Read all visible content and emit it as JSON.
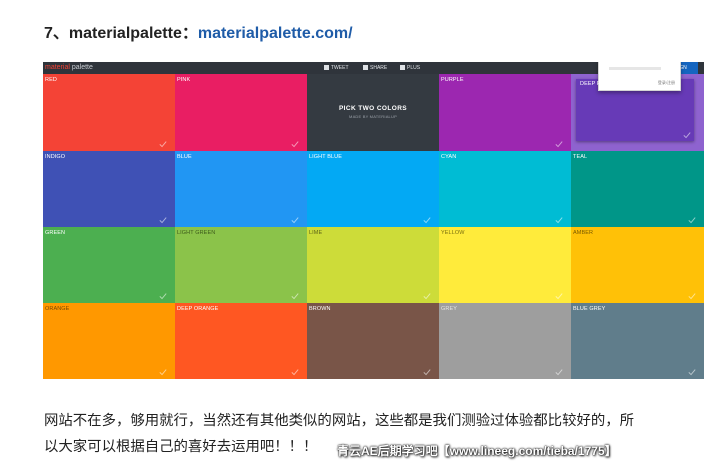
{
  "article": {
    "heading_prefix": "7、materialpalette：",
    "heading_link": "materialpalette.com/",
    "paragraph_line1": "网站不在多，够用就行，当然还有其他类似的网站，这些都是我们测验过体验都比较好的，所",
    "paragraph_line2": "以大家可以根据自己的喜好去运用吧！！！",
    "watermark": "青云AE后期学习吧【www.lineeg.com/tieba/1775】"
  },
  "screenshot": {
    "brand_accent": "material",
    "brand_rest": " palette",
    "tweet": "TWEET",
    "share": "SHARE",
    "plus": "PLUS",
    "signin": "GN",
    "popup_text": "登录/注册",
    "center_title": "PICK TWO COLORS",
    "center_subtitle": "MADE BY MATERIALUP",
    "tiles": [
      {
        "name": "RED",
        "color": "#f44336",
        "text_color": "#ffffff"
      },
      {
        "name": "PINK",
        "color": "#e91e63",
        "text_color": "#ffffff"
      },
      {
        "name": "",
        "color": "#343a41",
        "text_color": "#ffffff"
      },
      {
        "name": "PURPLE",
        "color": "#9c27b0",
        "text_color": "#ffffff"
      },
      {
        "name": "DEEP P",
        "color": "#673ab7",
        "text_color": "#ffffff"
      },
      {
        "name": "INDIGO",
        "color": "#3f51b5",
        "text_color": "#ffffff"
      },
      {
        "name": "BLUE",
        "color": "#2196f3",
        "text_color": "#ffffff"
      },
      {
        "name": "LIGHT BLUE",
        "color": "#03a9f4",
        "text_color": "#ffffff"
      },
      {
        "name": "CYAN",
        "color": "#00bcd4",
        "text_color": "#ffffff"
      },
      {
        "name": "TEAL",
        "color": "#009688",
        "text_color": "#ffffff"
      },
      {
        "name": "GREEN",
        "color": "#4caf50",
        "text_color": "#ffffff"
      },
      {
        "name": "LIGHT GREEN",
        "color": "#8bc34a",
        "text_color": "#3d5a1c"
      },
      {
        "name": "LIME",
        "color": "#cddc39",
        "text_color": "#5d6519"
      },
      {
        "name": "YELLOW",
        "color": "#ffeb3b",
        "text_color": "#7a6f10"
      },
      {
        "name": "AMBER",
        "color": "#ffc107",
        "text_color": "#7a5b00"
      },
      {
        "name": "ORANGE",
        "color": "#ff9800",
        "text_color": "#7a4900"
      },
      {
        "name": "DEEP ORANGE",
        "color": "#ff5722",
        "text_color": "#ffffff"
      },
      {
        "name": "BROWN",
        "color": "#795548",
        "text_color": "#ffffff"
      },
      {
        "name": "GREY",
        "color": "#9e9e9e",
        "text_color": "#e6e6e6"
      },
      {
        "name": "BLUE GREY",
        "color": "#607d8b",
        "text_color": "#ffffff"
      }
    ]
  }
}
